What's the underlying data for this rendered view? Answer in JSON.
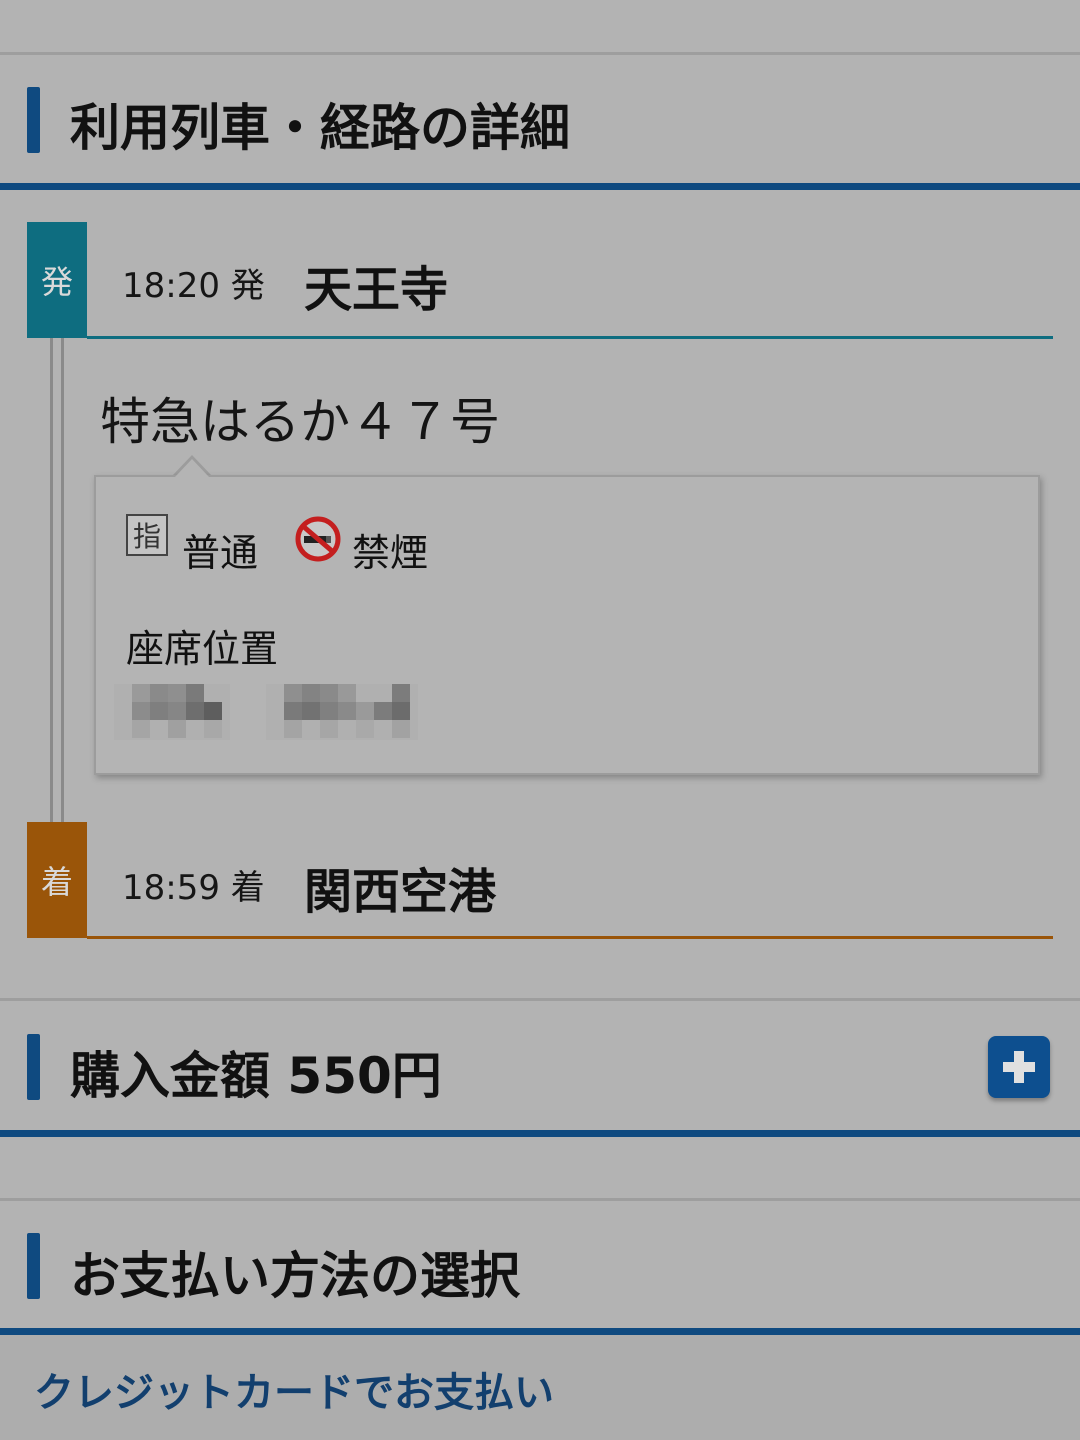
{
  "route_section": {
    "title": "利用列車・経路の詳細"
  },
  "departure": {
    "badge": "発",
    "time": "18:20 発",
    "station": "天王寺"
  },
  "train": {
    "name": "特急はるか４７号",
    "reserved_icon": "指",
    "seat_class": "普通",
    "smoking_label": "禁煙",
    "seat_position_label": "座席位置"
  },
  "arrival": {
    "badge": "着",
    "time": "18:59 着",
    "station": "関西空港"
  },
  "purchase_section": {
    "title": "購入金額 550円"
  },
  "payment_section": {
    "title": "お支払い方法の選択",
    "credit_card_link": "クレジットカードでお支払い"
  },
  "colors": {
    "accent_blue": "#0f4a80",
    "departure_teal": "#0e6d80",
    "arrival_orange": "#9a5509",
    "background": "#b3b3b3"
  }
}
